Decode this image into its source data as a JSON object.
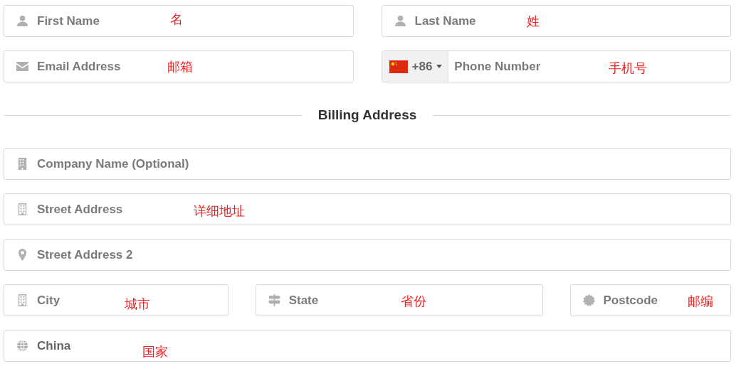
{
  "contact": {
    "first_name": {
      "placeholder": "First Name",
      "annotation": "名"
    },
    "last_name": {
      "placeholder": "Last Name",
      "annotation": "姓"
    },
    "email": {
      "placeholder": "Email Address",
      "annotation": "邮箱"
    },
    "phone": {
      "country_code": "+86",
      "placeholder": "Phone Number",
      "annotation": "手机号"
    }
  },
  "billing_heading": "Billing Address",
  "billing": {
    "company": {
      "placeholder": "Company Name (Optional)"
    },
    "street": {
      "placeholder": "Street Address",
      "annotation": "详细地址"
    },
    "street2": {
      "placeholder": "Street Address 2"
    },
    "city": {
      "placeholder": "City",
      "annotation": "城市"
    },
    "state": {
      "placeholder": "State",
      "annotation": "省份"
    },
    "postcode": {
      "placeholder": "Postcode",
      "annotation": "邮编"
    },
    "country": {
      "value": "China",
      "annotation": "国家"
    }
  }
}
